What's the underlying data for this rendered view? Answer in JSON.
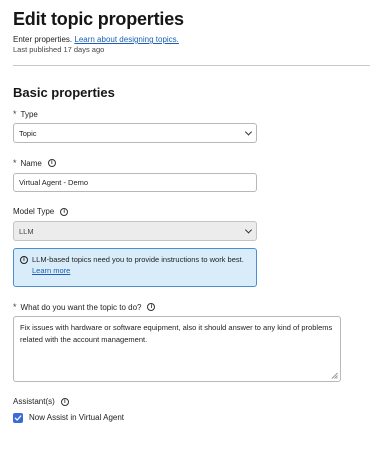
{
  "header": {
    "title": "Edit topic properties",
    "intro_text": "Enter properties.",
    "learn_link": "Learn about designing topics.",
    "last_published": "Last published 17 days ago"
  },
  "section": {
    "title": "Basic properties"
  },
  "required_marker": "*",
  "fields": {
    "type": {
      "label": "Type",
      "value": "Topic"
    },
    "name": {
      "label": "Name",
      "value": "Virtual Agent - Demo"
    },
    "model_type": {
      "label": "Model Type",
      "value": "LLM"
    },
    "goal": {
      "label": "What do you want the topic to do?",
      "value": "Fix issues with hardware or software equipment, also it should answer to any kind of problems related with the account management."
    },
    "assistants": {
      "label": "Assistant(s)",
      "option_label": "Now Assist in Virtual Agent",
      "checked": true
    }
  },
  "notice": {
    "text": "LLM-based topics need you to provide instructions to work best.",
    "link": "Learn more"
  },
  "icons": {
    "info": "info-circle-icon",
    "chevron": "chevron-down-icon",
    "check": "checkmark-icon",
    "resize": "resize-grip-icon"
  },
  "colors": {
    "link": "#1a5fb4",
    "notice_bg": "#d9ecf9",
    "notice_border": "#4b8fd1",
    "checkbox": "#3b6bd6"
  }
}
